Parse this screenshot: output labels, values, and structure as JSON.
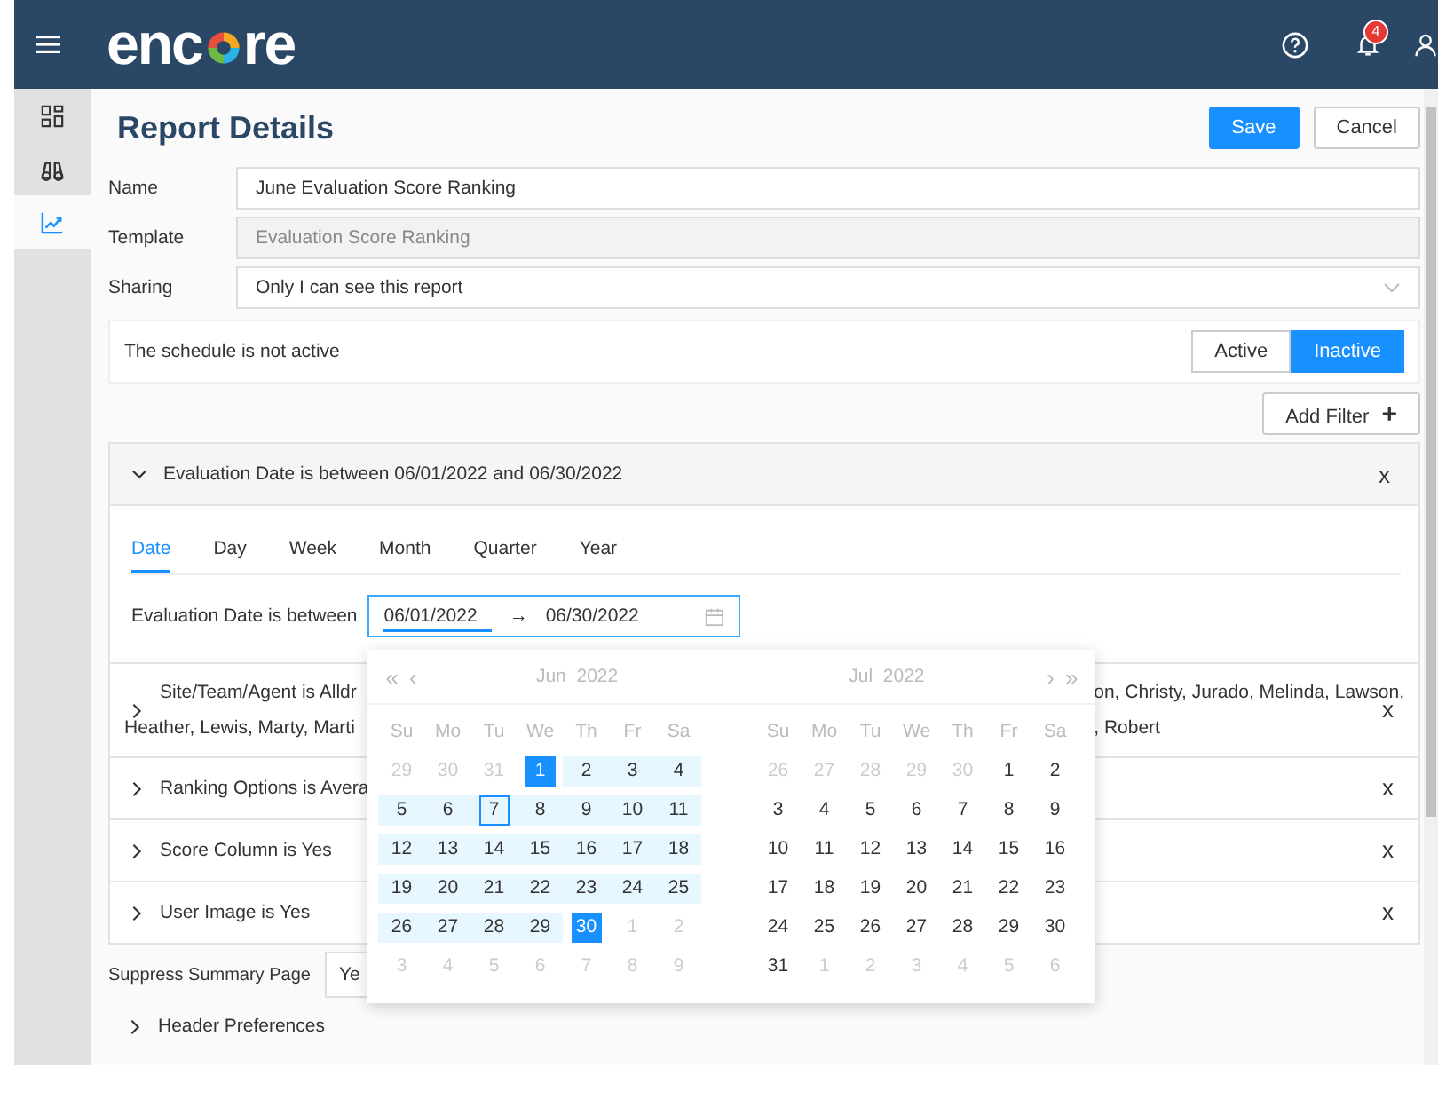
{
  "topbar": {
    "logo_left": "enc",
    "logo_right": "re",
    "notification_count": "4"
  },
  "sidebar": {
    "items": [
      {
        "kind": "grid",
        "selected": false
      },
      {
        "kind": "binoculars",
        "selected": false
      },
      {
        "kind": "chart",
        "selected": true
      }
    ]
  },
  "title": "Report Details",
  "actions": [
    {
      "label": "Save",
      "primary": true
    },
    {
      "label": "Cancel",
      "primary": false
    }
  ],
  "fields": [
    {
      "label": "Name",
      "value": "June Evaluation Score Ranking",
      "kind": "text"
    },
    {
      "label": "Template",
      "value": "Evaluation Score Ranking",
      "kind": "readonly"
    },
    {
      "label": "Sharing",
      "value": "Only I can see this report",
      "kind": "select"
    }
  ],
  "schedule": {
    "text": "The schedule is not active",
    "options": [
      {
        "label": "Active",
        "selected": false
      },
      {
        "label": "Inactive",
        "selected": true
      }
    ]
  },
  "add_filter": {
    "label": "Add Filter",
    "icon": "+"
  },
  "date_filter": {
    "title": "Evaluation Date is between 06/01/2022 and 06/30/2022",
    "close": "x",
    "tabs": [
      {
        "label": "Date",
        "selected": true
      },
      {
        "label": "Day",
        "selected": false
      },
      {
        "label": "Week",
        "selected": false
      },
      {
        "label": "Month",
        "selected": false
      },
      {
        "label": "Quarter",
        "selected": false
      },
      {
        "label": "Year",
        "selected": false
      }
    ],
    "range_label": "Evaluation Date is between",
    "start": "06/01/2022",
    "arrow": "→",
    "end": "06/30/2022"
  },
  "calendar": {
    "prev_year": "«",
    "prev_month": "‹",
    "next_month": "›",
    "next_year": "»",
    "months": [
      {
        "month": "Jun",
        "year": "2022",
        "weekdays": [
          "Su",
          "Mo",
          "Tu",
          "We",
          "Th",
          "Fr",
          "Sa"
        ],
        "weeks": [
          [
            {
              "d": "29",
              "muted": true,
              "in_range": false,
              "selected": false,
              "today": false
            },
            {
              "d": "30",
              "muted": true,
              "in_range": false,
              "selected": false,
              "today": false
            },
            {
              "d": "31",
              "muted": true,
              "in_range": false,
              "selected": false,
              "today": false
            },
            {
              "d": "1",
              "muted": false,
              "in_range": false,
              "selected": true,
              "today": false
            },
            {
              "d": "2",
              "muted": false,
              "in_range": true,
              "selected": false,
              "today": false
            },
            {
              "d": "3",
              "muted": false,
              "in_range": true,
              "selected": false,
              "today": false
            },
            {
              "d": "4",
              "muted": false,
              "in_range": true,
              "selected": false,
              "today": false
            }
          ],
          [
            {
              "d": "5",
              "muted": false,
              "in_range": true,
              "selected": false,
              "today": false
            },
            {
              "d": "6",
              "muted": false,
              "in_range": true,
              "selected": false,
              "today": false
            },
            {
              "d": "7",
              "muted": false,
              "in_range": true,
              "selected": false,
              "today": true
            },
            {
              "d": "8",
              "muted": false,
              "in_range": true,
              "selected": false,
              "today": false
            },
            {
              "d": "9",
              "muted": false,
              "in_range": true,
              "selected": false,
              "today": false
            },
            {
              "d": "10",
              "muted": false,
              "in_range": true,
              "selected": false,
              "today": false
            },
            {
              "d": "11",
              "muted": false,
              "in_range": true,
              "selected": false,
              "today": false
            }
          ],
          [
            {
              "d": "12",
              "muted": false,
              "in_range": true,
              "selected": false,
              "today": false
            },
            {
              "d": "13",
              "muted": false,
              "in_range": true,
              "selected": false,
              "today": false
            },
            {
              "d": "14",
              "muted": false,
              "in_range": true,
              "selected": false,
              "today": false
            },
            {
              "d": "15",
              "muted": false,
              "in_range": true,
              "selected": false,
              "today": false
            },
            {
              "d": "16",
              "muted": false,
              "in_range": true,
              "selected": false,
              "today": false
            },
            {
              "d": "17",
              "muted": false,
              "in_range": true,
              "selected": false,
              "today": false
            },
            {
              "d": "18",
              "muted": false,
              "in_range": true,
              "selected": false,
              "today": false
            }
          ],
          [
            {
              "d": "19",
              "muted": false,
              "in_range": true,
              "selected": false,
              "today": false
            },
            {
              "d": "20",
              "muted": false,
              "in_range": true,
              "selected": false,
              "today": false
            },
            {
              "d": "21",
              "muted": false,
              "in_range": true,
              "selected": false,
              "today": false
            },
            {
              "d": "22",
              "muted": false,
              "in_range": true,
              "selected": false,
              "today": false
            },
            {
              "d": "23",
              "muted": false,
              "in_range": true,
              "selected": false,
              "today": false
            },
            {
              "d": "24",
              "muted": false,
              "in_range": true,
              "selected": false,
              "today": false
            },
            {
              "d": "25",
              "muted": false,
              "in_range": true,
              "selected": false,
              "today": false
            }
          ],
          [
            {
              "d": "26",
              "muted": false,
              "in_range": true,
              "selected": false,
              "today": false
            },
            {
              "d": "27",
              "muted": false,
              "in_range": true,
              "selected": false,
              "today": false
            },
            {
              "d": "28",
              "muted": false,
              "in_range": true,
              "selected": false,
              "today": false
            },
            {
              "d": "29",
              "muted": false,
              "in_range": true,
              "selected": false,
              "today": false
            },
            {
              "d": "30",
              "muted": false,
              "in_range": false,
              "selected": true,
              "today": false
            },
            {
              "d": "1",
              "muted": true,
              "in_range": false,
              "selected": false,
              "today": false
            },
            {
              "d": "2",
              "muted": true,
              "in_range": false,
              "selected": false,
              "today": false
            }
          ],
          [
            {
              "d": "3",
              "muted": true,
              "in_range": false,
              "selected": false,
              "today": false
            },
            {
              "d": "4",
              "muted": true,
              "in_range": false,
              "selected": false,
              "today": false
            },
            {
              "d": "5",
              "muted": true,
              "in_range": false,
              "selected": false,
              "today": false
            },
            {
              "d": "6",
              "muted": true,
              "in_range": false,
              "selected": false,
              "today": false
            },
            {
              "d": "7",
              "muted": true,
              "in_range": false,
              "selected": false,
              "today": false
            },
            {
              "d": "8",
              "muted": true,
              "in_range": false,
              "selected": false,
              "today": false
            },
            {
              "d": "9",
              "muted": true,
              "in_range": false,
              "selected": false,
              "today": false
            }
          ]
        ]
      },
      {
        "month": "Jul",
        "year": "2022",
        "weekdays": [
          "Su",
          "Mo",
          "Tu",
          "We",
          "Th",
          "Fr",
          "Sa"
        ],
        "weeks": [
          [
            {
              "d": "26",
              "muted": true,
              "in_range": false,
              "selected": false,
              "today": false
            },
            {
              "d": "27",
              "muted": true,
              "in_range": false,
              "selected": false,
              "today": false
            },
            {
              "d": "28",
              "muted": true,
              "in_range": false,
              "selected": false,
              "today": false
            },
            {
              "d": "29",
              "muted": true,
              "in_range": false,
              "selected": false,
              "today": false
            },
            {
              "d": "30",
              "muted": true,
              "in_range": false,
              "selected": false,
              "today": false
            },
            {
              "d": "1",
              "muted": false,
              "in_range": false,
              "selected": false,
              "today": false
            },
            {
              "d": "2",
              "muted": false,
              "in_range": false,
              "selected": false,
              "today": false
            }
          ],
          [
            {
              "d": "3",
              "muted": false,
              "in_range": false,
              "selected": false,
              "today": false
            },
            {
              "d": "4",
              "muted": false,
              "in_range": false,
              "selected": false,
              "today": false
            },
            {
              "d": "5",
              "muted": false,
              "in_range": false,
              "selected": false,
              "today": false
            },
            {
              "d": "6",
              "muted": false,
              "in_range": false,
              "selected": false,
              "today": false
            },
            {
              "d": "7",
              "muted": false,
              "in_range": false,
              "selected": false,
              "today": false
            },
            {
              "d": "8",
              "muted": false,
              "in_range": false,
              "selected": false,
              "today": false
            },
            {
              "d": "9",
              "muted": false,
              "in_range": false,
              "selected": false,
              "today": false
            }
          ],
          [
            {
              "d": "10",
              "muted": false,
              "in_range": false,
              "selected": false,
              "today": false
            },
            {
              "d": "11",
              "muted": false,
              "in_range": false,
              "selected": false,
              "today": false
            },
            {
              "d": "12",
              "muted": false,
              "in_range": false,
              "selected": false,
              "today": false
            },
            {
              "d": "13",
              "muted": false,
              "in_range": false,
              "selected": false,
              "today": false
            },
            {
              "d": "14",
              "muted": false,
              "in_range": false,
              "selected": false,
              "today": false
            },
            {
              "d": "15",
              "muted": false,
              "in_range": false,
              "selected": false,
              "today": false
            },
            {
              "d": "16",
              "muted": false,
              "in_range": false,
              "selected": false,
              "today": false
            }
          ],
          [
            {
              "d": "17",
              "muted": false,
              "in_range": false,
              "selected": false,
              "today": false
            },
            {
              "d": "18",
              "muted": false,
              "in_range": false,
              "selected": false,
              "today": false
            },
            {
              "d": "19",
              "muted": false,
              "in_range": false,
              "selected": false,
              "today": false
            },
            {
              "d": "20",
              "muted": false,
              "in_range": false,
              "selected": false,
              "today": false
            },
            {
              "d": "21",
              "muted": false,
              "in_range": false,
              "selected": false,
              "today": false
            },
            {
              "d": "22",
              "muted": false,
              "in_range": false,
              "selected": false,
              "today": false
            },
            {
              "d": "23",
              "muted": false,
              "in_range": false,
              "selected": false,
              "today": false
            }
          ],
          [
            {
              "d": "24",
              "muted": false,
              "in_range": false,
              "selected": false,
              "today": false
            },
            {
              "d": "25",
              "muted": false,
              "in_range": false,
              "selected": false,
              "today": false
            },
            {
              "d": "26",
              "muted": false,
              "in_range": false,
              "selected": false,
              "today": false
            },
            {
              "d": "27",
              "muted": false,
              "in_range": false,
              "selected": false,
              "today": false
            },
            {
              "d": "28",
              "muted": false,
              "in_range": false,
              "selected": false,
              "today": false
            },
            {
              "d": "29",
              "muted": false,
              "in_range": false,
              "selected": false,
              "today": false
            },
            {
              "d": "30",
              "muted": false,
              "in_range": false,
              "selected": false,
              "today": false
            }
          ],
          [
            {
              "d": "31",
              "muted": false,
              "in_range": false,
              "selected": false,
              "today": false
            },
            {
              "d": "1",
              "muted": true,
              "in_range": false,
              "selected": false,
              "today": false
            },
            {
              "d": "2",
              "muted": true,
              "in_range": false,
              "selected": false,
              "today": false
            },
            {
              "d": "3",
              "muted": true,
              "in_range": false,
              "selected": false,
              "today": false
            },
            {
              "d": "4",
              "muted": true,
              "in_range": false,
              "selected": false,
              "today": false
            },
            {
              "d": "5",
              "muted": true,
              "in_range": false,
              "selected": false,
              "today": false
            },
            {
              "d": "6",
              "muted": true,
              "in_range": false,
              "selected": false,
              "today": false
            }
          ]
        ]
      }
    ]
  },
  "filters": [
    {
      "left": [
        "Site/Team/Agent is Alldr",
        "Heather, Lewis, Marty, Marti"
      ],
      "right": [
        "on, Christy, Jurado, Melinda, Lawson,",
        ", Robert"
      ],
      "close": "x"
    },
    {
      "left": [
        "Ranking Options is Avera"
      ],
      "close": "x"
    },
    {
      "left": [
        "Score Column is Yes"
      ],
      "close": "x"
    },
    {
      "left": [
        "User Image is Yes"
      ],
      "close": "x"
    }
  ],
  "suppress": {
    "label": "Suppress Summary Page",
    "value": "Ye"
  },
  "header_preferences": {
    "label": "Header Preferences",
    "expanded": false
  }
}
